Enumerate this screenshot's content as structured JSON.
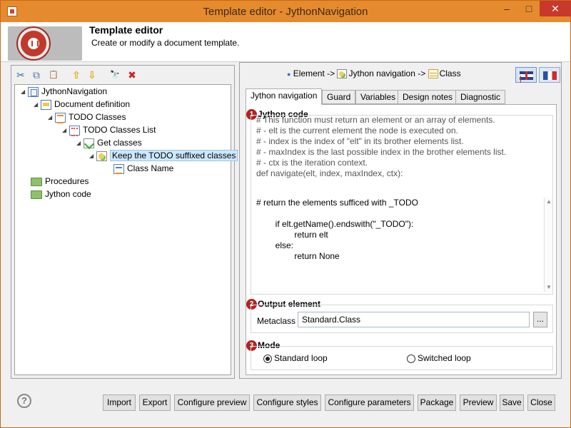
{
  "window": {
    "title": "Template editor - JythonNavigation",
    "minimize": "–",
    "maximize": "□",
    "close": "✕"
  },
  "banner": {
    "title": "Template editor",
    "subtitle": "Create or modify a document template."
  },
  "toolbar": {
    "cut_icon": "✂",
    "copy_icon": "⧉",
    "paste_icon": "📋",
    "up_icon": "⇧",
    "down_icon": "⇩",
    "find_icon": "🔭",
    "delete_icon": "✖"
  },
  "tree": {
    "items": [
      {
        "label": "JythonNavigation",
        "icon": "project-icon"
      },
      {
        "label": "Document definition",
        "icon": "document-icon"
      },
      {
        "label": "TODO Classes",
        "icon": "class-icon"
      },
      {
        "label": "TODO Classes List",
        "icon": "list-icon"
      },
      {
        "label": "Get classes",
        "icon": "get-icon"
      },
      {
        "label": "Keep the TODO suffixed classes",
        "icon": "navigation-icon"
      },
      {
        "label": "Class Name",
        "icon": "class-name-icon"
      },
      {
        "label": "Procedures",
        "icon": "folder-icon"
      },
      {
        "label": "Jython code",
        "icon": "folder-icon"
      }
    ]
  },
  "breadcrumb": {
    "part1": "Element ->",
    "part2": "Jython navigation ->",
    "part3": "Class"
  },
  "tabs": [
    "Jython navigation",
    "Guard",
    "Variables",
    "Design notes",
    "Diagnostic"
  ],
  "sections": {
    "jython": {
      "badge": "1",
      "title": "Jython code"
    },
    "output": {
      "badge": "2",
      "title": "Output element"
    },
    "mode": {
      "badge": "3",
      "title": "Mode"
    }
  },
  "code": {
    "lines": [
      "# This function must return an element or an array of elements.",
      "# - elt is the current element the node is executed on.",
      "# - index is the index of \"elt\" in its brother elements list.",
      "# - maxIndex is the last possible index in the brother elements list.",
      "# - ctx is the iteration context.",
      "def navigate(elt, index, maxIndex, ctx):"
    ],
    "body": [
      "# return the elements sufficed with _TODO",
      "",
      "        if elt.getName().endswith(\"_TODO\"):",
      "                return elt",
      "        else:",
      "                return None"
    ]
  },
  "output": {
    "label": "Metaclass",
    "value": "Standard.Class",
    "browse": "..."
  },
  "mode": {
    "standard": "Standard loop",
    "switched": "Switched loop",
    "selected": "standard"
  },
  "buttons": {
    "help": "?",
    "import": "Import",
    "export": "Export",
    "preview_cfg": "Configure preview",
    "styles": "Configure styles",
    "params": "Configure parameters",
    "package": "Package",
    "preview": "Preview",
    "save": "Save",
    "close": "Close"
  }
}
